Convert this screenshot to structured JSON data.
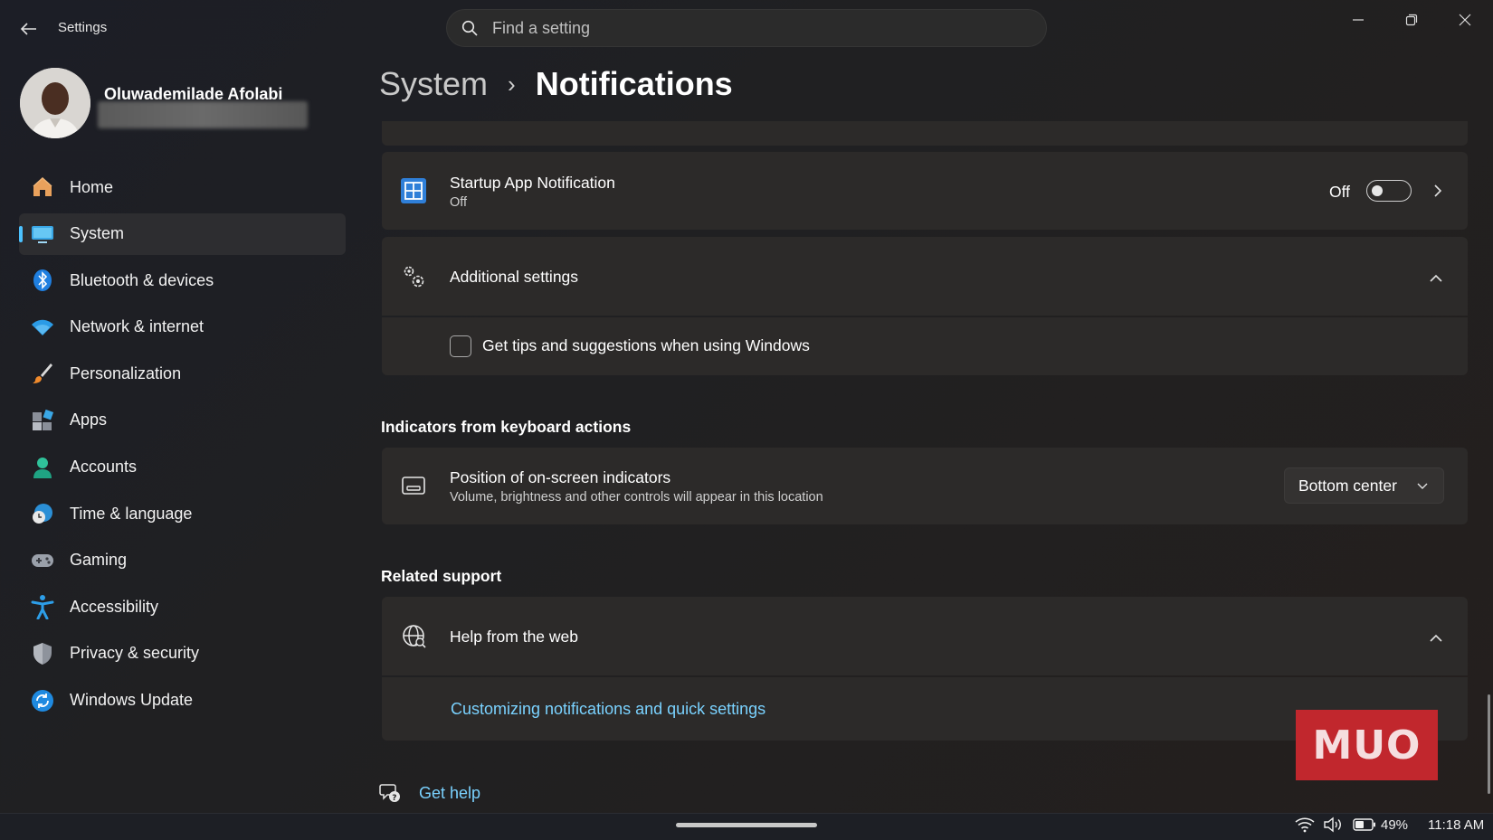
{
  "window": {
    "app_title": "Settings",
    "back_icon": "back-arrow-icon",
    "controls": [
      "minimize-icon",
      "restore-icon",
      "close-icon"
    ]
  },
  "search": {
    "placeholder": "Find a setting",
    "value": ""
  },
  "user": {
    "name": "Oluwademilade Afolabi"
  },
  "sidebar": {
    "active": "System",
    "accent": "#4cc2ff",
    "items": [
      {
        "label": "Home",
        "icon": "home-icon"
      },
      {
        "label": "System",
        "icon": "system-display-icon"
      },
      {
        "label": "Bluetooth & devices",
        "icon": "bluetooth-icon"
      },
      {
        "label": "Network & internet",
        "icon": "wifi-icon"
      },
      {
        "label": "Personalization",
        "icon": "paintbrush-icon"
      },
      {
        "label": "Apps",
        "icon": "apps-icon"
      },
      {
        "label": "Accounts",
        "icon": "accounts-icon"
      },
      {
        "label": "Time & language",
        "icon": "time-language-icon"
      },
      {
        "label": "Gaming",
        "icon": "gamepad-icon"
      },
      {
        "label": "Accessibility",
        "icon": "accessibility-icon"
      },
      {
        "label": "Privacy & security",
        "icon": "shield-icon"
      },
      {
        "label": "Windows Update",
        "icon": "update-icon"
      }
    ]
  },
  "breadcrumb": {
    "parent": "System",
    "separator": "›",
    "current": "Notifications"
  },
  "main": {
    "startup_notification": {
      "title": "Startup App Notification",
      "subtitle": "Off",
      "state_label": "Off",
      "toggle_on": false
    },
    "additional_settings": {
      "title": "Additional settings",
      "expanded": true,
      "checkbox_label": "Get tips and suggestions when using Windows",
      "checked": false
    },
    "indicators_section": {
      "heading": "Indicators from keyboard actions",
      "title": "Position of on-screen indicators",
      "subtitle": "Volume, brightness and other controls will appear in this location",
      "selected": "Bottom center"
    },
    "related_support": {
      "heading": "Related support",
      "help_title": "Help from the web",
      "link": "Customizing notifications and quick settings"
    },
    "get_help": "Get help"
  },
  "watermark": {
    "text": "MUO",
    "color": "#c1272d"
  },
  "taskbar": {
    "battery": "49%",
    "time": "11:18 AM"
  }
}
